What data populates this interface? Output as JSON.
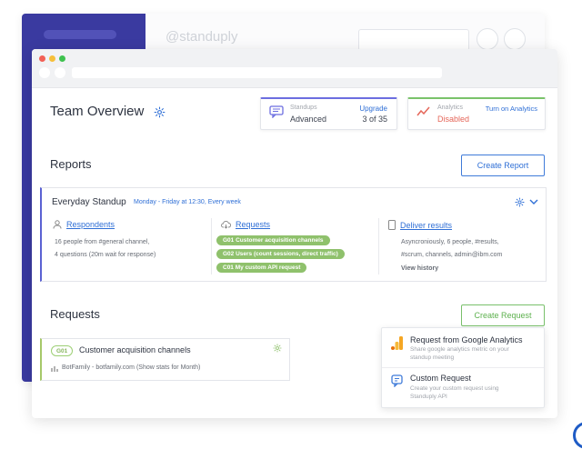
{
  "background_window": {
    "handle": "@standuply"
  },
  "page": {
    "title": "Team Overview"
  },
  "stats": {
    "standups": {
      "label": "Standups",
      "value": "Advanced",
      "action": "Upgrade",
      "count": "3 of 35"
    },
    "analytics": {
      "label": "Analytics",
      "value": "Disabled",
      "action": "Turn on Analytics"
    }
  },
  "reports": {
    "section_title": "Reports",
    "create_button": "Create Report",
    "standup": {
      "name": "Everyday Standup",
      "schedule": "Monday - Friday at 12:30, Every week",
      "respondents": {
        "heading": "Respondents",
        "line1": "16 people from #general channel,",
        "line2": "4 questions (20m wait for response)"
      },
      "requests": {
        "heading": "Requests",
        "tags": [
          "G01  Customer acquisition channels",
          "G02  Users (count sessions, direct traffic)",
          "C01  My custom API request"
        ]
      },
      "deliver": {
        "heading": "Deliver results",
        "line1": "Asyncroniously, 6 people, #results,",
        "line2": "#scrum, channels, admin@ibm.com",
        "view_history": "View history"
      }
    }
  },
  "requests": {
    "section_title": "Requests",
    "create_button": "Create Request",
    "items": [
      {
        "code": "G01",
        "name": "Customer acquisition channels",
        "source": "BotFamily - botfamily.com (Show stats for Month)"
      }
    ]
  },
  "request_menu": {
    "items": [
      {
        "title": "Request from Google Analytics",
        "desc1": "Share google analytics metric on your",
        "desc2": "standup meeting",
        "icon": "google-analytics-icon"
      },
      {
        "title": "Custom Request",
        "desc1": "Create your custom request using",
        "desc2": "Standuply API",
        "icon": "custom-request-icon"
      }
    ]
  },
  "colors": {
    "accent_blue": "#2f6fd6",
    "sidebar": "#3a3aa0",
    "tag_green": "#8fc16c",
    "disabled_red": "#e5675a"
  }
}
